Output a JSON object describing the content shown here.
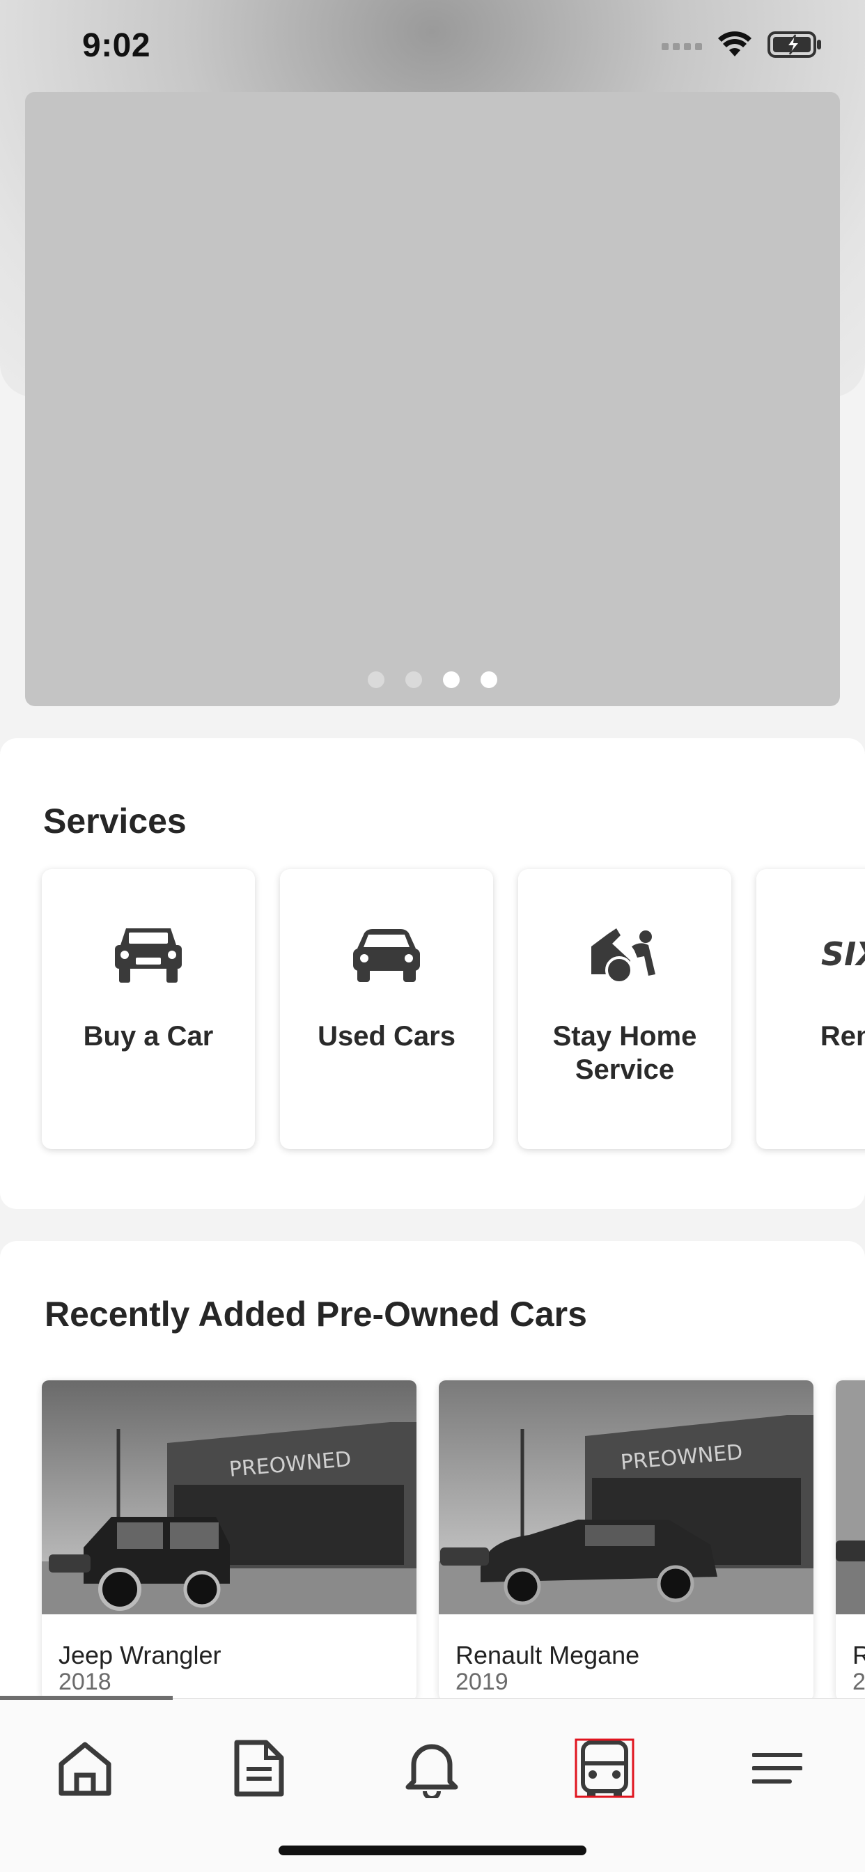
{
  "status_bar": {
    "time": "9:02"
  },
  "banner": {
    "slide_count": 4,
    "active_slides": [
      3,
      4
    ]
  },
  "services": {
    "title": "Services",
    "items": [
      {
        "label": "Buy a Car",
        "icon": "suv-front-icon"
      },
      {
        "label": "Used Cars",
        "icon": "car-front-icon"
      },
      {
        "label": "Stay Home Service",
        "icon": "mechanic-icon"
      },
      {
        "label": "Rent a",
        "icon": "rental-logo-icon"
      }
    ]
  },
  "recent": {
    "title": "Recently Added Pre-Owned Cars",
    "photo_sign": "PREOWNED",
    "cars": [
      {
        "name": "Jeep Wrangler",
        "year": "2018"
      },
      {
        "name": "Renault Megane",
        "year": "2019"
      },
      {
        "name": "R",
        "year": "2"
      }
    ]
  },
  "tab_bar": {
    "items": [
      "home-icon",
      "document-icon",
      "bell-icon",
      "car-icon",
      "menu-icon"
    ],
    "active": "car-icon",
    "colors": {
      "active_outline": "#e0141e",
      "icon": "#3a3a3a"
    }
  }
}
